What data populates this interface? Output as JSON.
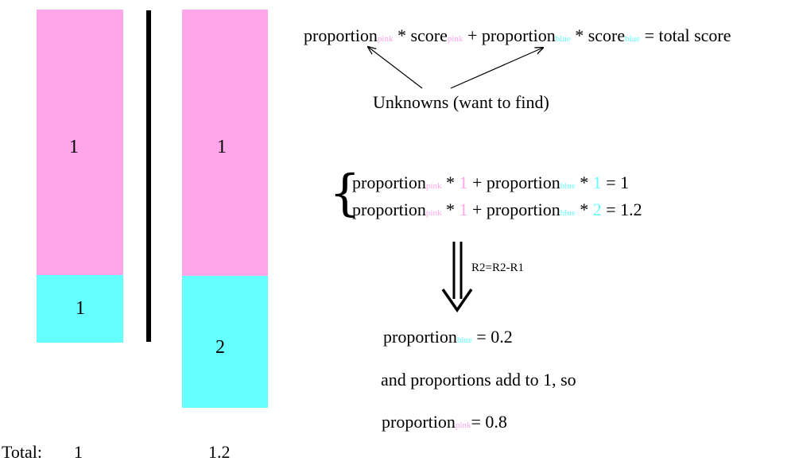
{
  "left_bar": {
    "top_value": "1",
    "bottom_value": "1"
  },
  "right_bar": {
    "top_value": "1",
    "bottom_value": "2"
  },
  "totals": {
    "label": "Total:",
    "left": "1",
    "right": "1.2"
  },
  "equation": {
    "proportion": "proportion",
    "score": "score",
    "pink": "pink",
    "blue": "blue",
    "times": "*",
    "plus": "+",
    "equals_total": "= total score"
  },
  "unknowns_label": "Unknowns (want to find)",
  "system": {
    "brace": "{",
    "row1": {
      "coef_pink": "1",
      "coef_blue": "1",
      "result": "= 1"
    },
    "row2": {
      "coef_pink": "1",
      "coef_blue": "2",
      "result": "= 1.2"
    }
  },
  "operation_label": "R2=R2-R1",
  "results": {
    "blue_line_value": "= 0.2",
    "middle_line": "and proportions add to 1, so",
    "pink_line_value": "= 0.8"
  },
  "colors": {
    "pink": "#ffa6eb",
    "cyan": "#66ffff"
  }
}
